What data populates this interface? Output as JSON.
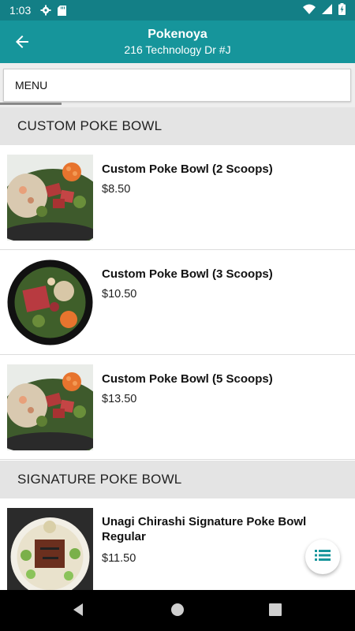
{
  "status_bar": {
    "time": "1:03",
    "icons_left": [
      "gear-icon",
      "sd-card-icon"
    ],
    "icons_right": [
      "wifi-icon",
      "signal-icon",
      "battery-icon"
    ]
  },
  "app_bar": {
    "title": "Pokenoya",
    "subtitle": "216 Technology Dr #J",
    "back_icon": "arrow-left-icon",
    "background": "#16959b"
  },
  "tabs": [
    {
      "label": "MENU",
      "selected": true
    }
  ],
  "sections": [
    {
      "title": "CUSTOM POKE BOWL",
      "items": [
        {
          "name": "Custom Poke Bowl (2 Scoops)",
          "price": "$8.50"
        },
        {
          "name": "Custom Poke Bowl (3 Scoops)",
          "price": "$10.50"
        },
        {
          "name": "Custom Poke Bowl (5 Scoops)",
          "price": "$13.50"
        }
      ]
    },
    {
      "title": "SIGNATURE POKE BOWL",
      "items": [
        {
          "name": "Unagi Chirashi Signature Poke Bowl Regular",
          "price": "$11.50"
        }
      ]
    }
  ],
  "fab": {
    "icon": "list-icon",
    "color": "#16959b"
  },
  "nav_bar": {
    "buttons": [
      "back-triangle-icon",
      "home-circle-icon",
      "recents-square-icon"
    ]
  }
}
